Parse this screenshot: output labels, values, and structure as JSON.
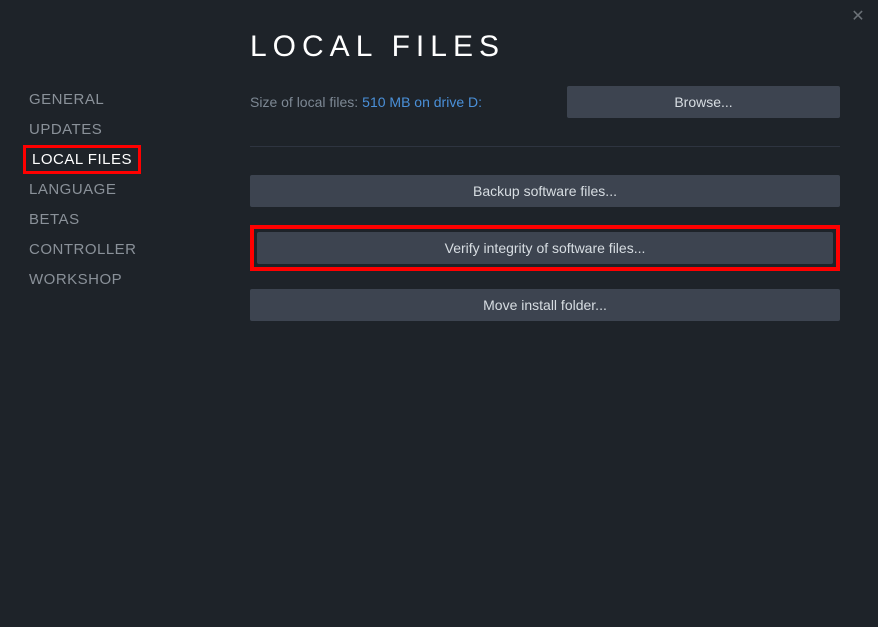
{
  "close_symbol": "✕",
  "sidebar": {
    "items": [
      {
        "label": "GENERAL",
        "active": false,
        "highlighted": false
      },
      {
        "label": "UPDATES",
        "active": false,
        "highlighted": false
      },
      {
        "label": "LOCAL FILES",
        "active": true,
        "highlighted": true
      },
      {
        "label": "LANGUAGE",
        "active": false,
        "highlighted": false
      },
      {
        "label": "BETAS",
        "active": false,
        "highlighted": false
      },
      {
        "label": "CONTROLLER",
        "active": false,
        "highlighted": false
      },
      {
        "label": "WORKSHOP",
        "active": false,
        "highlighted": false
      }
    ]
  },
  "main": {
    "title": "LOCAL FILES",
    "size_label": "Size of local files:",
    "size_value": "510 MB on drive D:",
    "browse_label": "Browse...",
    "buttons": {
      "backup": "Backup software files...",
      "verify": "Verify integrity of software files...",
      "move": "Move install folder..."
    }
  }
}
